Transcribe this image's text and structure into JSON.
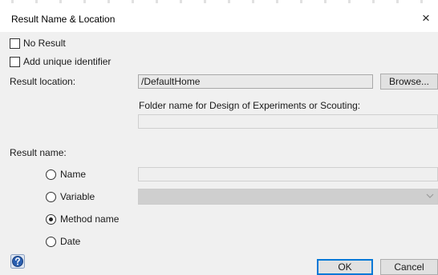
{
  "window": {
    "title": "Result Name & Location",
    "close_glyph": "×"
  },
  "options": {
    "no_result_label": "No Result",
    "no_result_checked": false,
    "add_unique_identifier_label": "Add unique identifier",
    "add_unique_identifier_checked": false
  },
  "location": {
    "label": "Result location:",
    "value": "/DefaultHome",
    "browse_label": "Browse...",
    "folder_label": "Folder name for Design of Experiments or Scouting:",
    "folder_value": ""
  },
  "result_name": {
    "label": "Result name:",
    "selected": "Method name",
    "options": [
      {
        "label": "Name",
        "checked": false
      },
      {
        "label": "Variable",
        "checked": false
      },
      {
        "label": "Method name",
        "checked": true
      },
      {
        "label": "Date",
        "checked": false
      }
    ],
    "name_value": "",
    "variable_value": ""
  },
  "footer": {
    "ok_label": "OK",
    "cancel_label": "Cancel"
  },
  "icons": {
    "help": "help-icon",
    "close": "close-icon",
    "dropdown": "chevron-down-icon"
  },
  "colors": {
    "accent": "#0078d7",
    "dialog_bg": "#f0f0f0",
    "titlebar_bg": "#ffffff"
  }
}
